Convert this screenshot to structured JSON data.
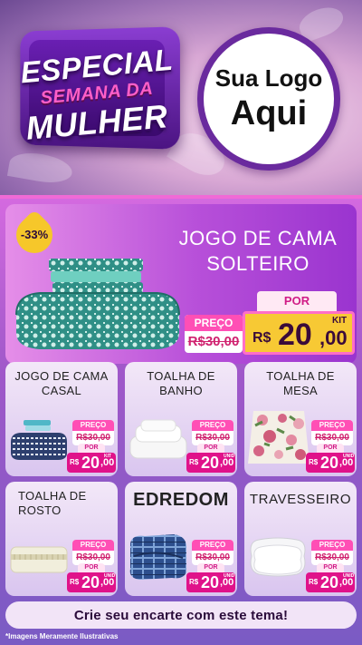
{
  "header": {
    "badge": {
      "line1": "ESPECIAL",
      "line2": "SEMANA DA",
      "line3": "MULHER"
    },
    "logo": {
      "line1": "Sua Logo",
      "line2": "Aqui"
    }
  },
  "hero": {
    "discount": "-33%",
    "title_line1": "JOGO DE CAMA",
    "title_line2": "SOLTEIRO",
    "old_label": "PREÇO",
    "old_value": "R$30,00",
    "new_label": "POR",
    "currency": "R$",
    "price_int": "20",
    "price_cents": ",00",
    "unit": "KIT"
  },
  "cards": [
    {
      "title1": "JOGO DE CAMA",
      "title2": "CASAL",
      "old_label": "PREÇO",
      "old_value": "R$30,00",
      "new_label": "POR",
      "currency": "R$",
      "price_int": "20",
      "price_cents": ",00",
      "unit": "KIT"
    },
    {
      "title1": "TOALHA DE",
      "title2": "BANHO",
      "old_label": "PREÇO",
      "old_value": "R$30,00",
      "new_label": "POR",
      "currency": "R$",
      "price_int": "20",
      "price_cents": ",00",
      "unit": "UNID"
    },
    {
      "title1": "TOALHA DE",
      "title2": "MESA",
      "old_label": "PREÇO",
      "old_value": "R$30,00",
      "new_label": "POR",
      "currency": "R$",
      "price_int": "20",
      "price_cents": ",00",
      "unit": "UNID"
    },
    {
      "title1": "TOALHA DE",
      "title2": "ROSTO",
      "old_label": "PREÇO",
      "old_value": "R$30,00",
      "new_label": "POR",
      "currency": "R$",
      "price_int": "20",
      "price_cents": ",00",
      "unit": "UNID"
    },
    {
      "title1": "EDREDOM",
      "title2": "",
      "old_label": "PREÇO",
      "old_value": "R$30,00",
      "new_label": "POR",
      "currency": "R$",
      "price_int": "20",
      "price_cents": ",00",
      "unit": "UNID"
    },
    {
      "title1": "TRAVESSEIRO",
      "title2": "",
      "old_label": "PREÇO",
      "old_value": "R$30,00",
      "new_label": "POR",
      "currency": "R$",
      "price_int": "20",
      "price_cents": ",00",
      "unit": "UNID"
    }
  ],
  "cta": "Crie seu encarte com este tema!",
  "disclaimer": "*Imagens Meramente Ilustrativas",
  "colors": {
    "accent_pink": "#e0128a",
    "price_yellow": "#f7c934",
    "purple": "#6a2a9e"
  }
}
